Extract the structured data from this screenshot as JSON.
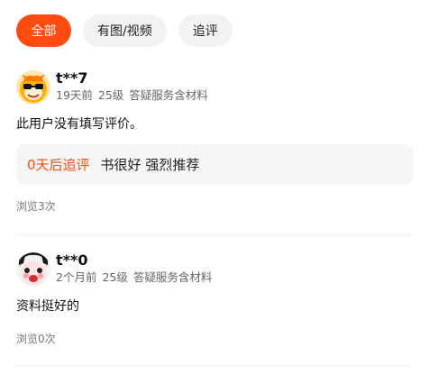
{
  "tabs": [
    {
      "label": "全部"
    },
    {
      "label": "有图/视频"
    },
    {
      "label": "追评"
    }
  ],
  "reviews": [
    {
      "username": "t**7",
      "time": "19天前",
      "level": "25级",
      "tags": "答疑服务含材料",
      "content": "此用户没有填写评价。",
      "follow_tag": "0天后追评",
      "follow_text": "书很好 强烈推荐",
      "views": "浏览3次"
    },
    {
      "username": "t**0",
      "time": "2个月前",
      "level": "25级",
      "tags": "答疑服务含材料",
      "content": "资料挺好的",
      "views": "浏览0次"
    }
  ],
  "colors": {
    "accent": "#ff4a10",
    "tab_inactive_bg": "#f3f3f3",
    "follow_bg": "#f6f6f6"
  }
}
